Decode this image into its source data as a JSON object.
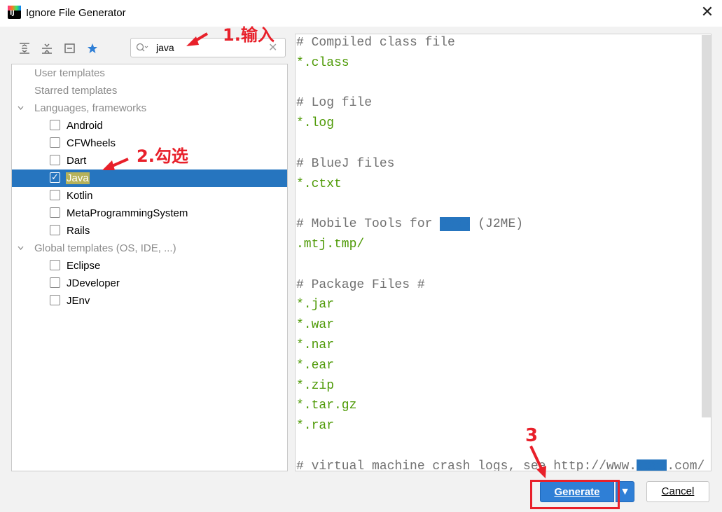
{
  "window": {
    "title": "Ignore File Generator"
  },
  "toolbar": {
    "icons": [
      "expand-all-icon",
      "collapse-all-icon",
      "collapse-icon",
      "star-icon"
    ],
    "star_color": "#2f7fd6"
  },
  "search": {
    "value": "java",
    "placeholder": ""
  },
  "tree": {
    "user_templates": "User templates",
    "starred_templates": "Starred templates",
    "languages": {
      "label": "Languages, frameworks",
      "items": [
        {
          "label": "Android",
          "checked": false
        },
        {
          "label": "CFWheels",
          "checked": false
        },
        {
          "label": "Dart",
          "checked": false
        },
        {
          "label": "Java",
          "checked": true,
          "selected": true
        },
        {
          "label": "Kotlin",
          "checked": false
        },
        {
          "label": "MetaProgrammingSystem",
          "checked": false
        },
        {
          "label": "Rails",
          "checked": false
        }
      ]
    },
    "global": {
      "label": "Global templates (OS, IDE, ...)",
      "items": [
        {
          "label": "Eclipse",
          "checked": false
        },
        {
          "label": "JDeveloper",
          "checked": false
        },
        {
          "label": "JEnv",
          "checked": false
        }
      ]
    }
  },
  "preview": {
    "lines": [
      {
        "text": "# Compiled class file",
        "kind": "comment"
      },
      {
        "text": "*.class",
        "kind": "pattern"
      },
      {
        "text": "",
        "kind": "blank"
      },
      {
        "text": "# Log file",
        "kind": "comment"
      },
      {
        "text": "*.log",
        "kind": "pattern"
      },
      {
        "text": "",
        "kind": "blank"
      },
      {
        "text": "# BlueJ files",
        "kind": "comment"
      },
      {
        "text": "*.ctxt",
        "kind": "pattern"
      },
      {
        "text": "",
        "kind": "blank"
      },
      {
        "text": "# Mobile Tools for Java (J2ME)",
        "kind": "comment"
      },
      {
        "text": ".mtj.tmp/",
        "kind": "pattern"
      },
      {
        "text": "",
        "kind": "blank"
      },
      {
        "text": "# Package Files #",
        "kind": "comment"
      },
      {
        "text": "*.jar",
        "kind": "pattern"
      },
      {
        "text": "*.war",
        "kind": "pattern"
      },
      {
        "text": "*.nar",
        "kind": "pattern"
      },
      {
        "text": "*.ear",
        "kind": "pattern"
      },
      {
        "text": "*.zip",
        "kind": "pattern"
      },
      {
        "text": "*.tar.gz",
        "kind": "pattern"
      },
      {
        "text": "*.rar",
        "kind": "pattern"
      },
      {
        "text": "",
        "kind": "blank"
      },
      {
        "text": "# virtual machine crash logs, see http://www.java.com/",
        "kind": "comment"
      }
    ],
    "highlight_term": "Java"
  },
  "buttons": {
    "generate": "Generate",
    "cancel": "Cancel"
  },
  "annotations": {
    "step1": "1.输入",
    "step2": "2.勾选",
    "step3": "3",
    "color": "#e8202a"
  }
}
